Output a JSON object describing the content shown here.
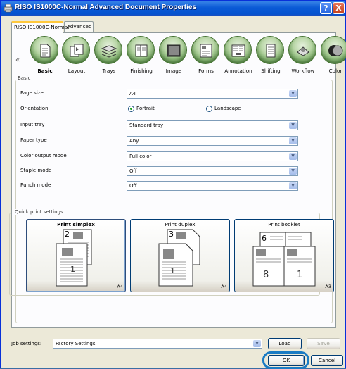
{
  "window": {
    "title": "RISO IS1000C-Normal Advanced Document Properties",
    "help_label": "?",
    "close_label": "X"
  },
  "tabs": [
    {
      "label": "RISO IS1000C-Normal",
      "active": true
    },
    {
      "label": "Advanced",
      "active": false
    }
  ],
  "scroll": {
    "left": "«",
    "right": "»"
  },
  "categories": [
    {
      "label": "Basic",
      "icon": "basic-document-icon",
      "selected": true
    },
    {
      "label": "Layout",
      "icon": "layout-icon"
    },
    {
      "label": "Trays",
      "icon": "trays-icon"
    },
    {
      "label": "Finishing",
      "icon": "finishing-icon"
    },
    {
      "label": "Image",
      "icon": "image-icon"
    },
    {
      "label": "Forms",
      "icon": "forms-icon"
    },
    {
      "label": "Annotation",
      "icon": "annotation-icon"
    },
    {
      "label": "Shifting",
      "icon": "shifting-icon"
    },
    {
      "label": "Workflow",
      "icon": "workflow-icon"
    },
    {
      "label": "Color",
      "icon": "color-icon"
    }
  ],
  "basic": {
    "group_label": "Basic",
    "page_size": {
      "label": "Page size",
      "value": "A4"
    },
    "orientation": {
      "label": "Orientation",
      "option1": "Portrait",
      "option2": "Landscape",
      "selected": "Portrait"
    },
    "input_tray": {
      "label": "Input tray",
      "value": "Standard tray"
    },
    "paper_type": {
      "label": "Paper type",
      "value": "Any"
    },
    "color_output": {
      "label": "Color output mode",
      "value": "Full color"
    },
    "staple": {
      "label": "Staple mode",
      "value": "Off"
    },
    "punch": {
      "label": "Punch mode",
      "value": "Off"
    }
  },
  "quick_print": {
    "group_label": "Quick print settings",
    "options": [
      {
        "title": "Print simplex",
        "size": "A4",
        "selected": true
      },
      {
        "title": "Print duplex",
        "size": "A4",
        "selected": false
      },
      {
        "title": "Print booklet",
        "size": "A3",
        "selected": false
      }
    ]
  },
  "footer": {
    "job_label": "Job settings:",
    "job_value": "Factory Settings",
    "load_label": "Load",
    "save_label": "Save",
    "ok_label": "OK",
    "cancel_label": "Cancel"
  }
}
